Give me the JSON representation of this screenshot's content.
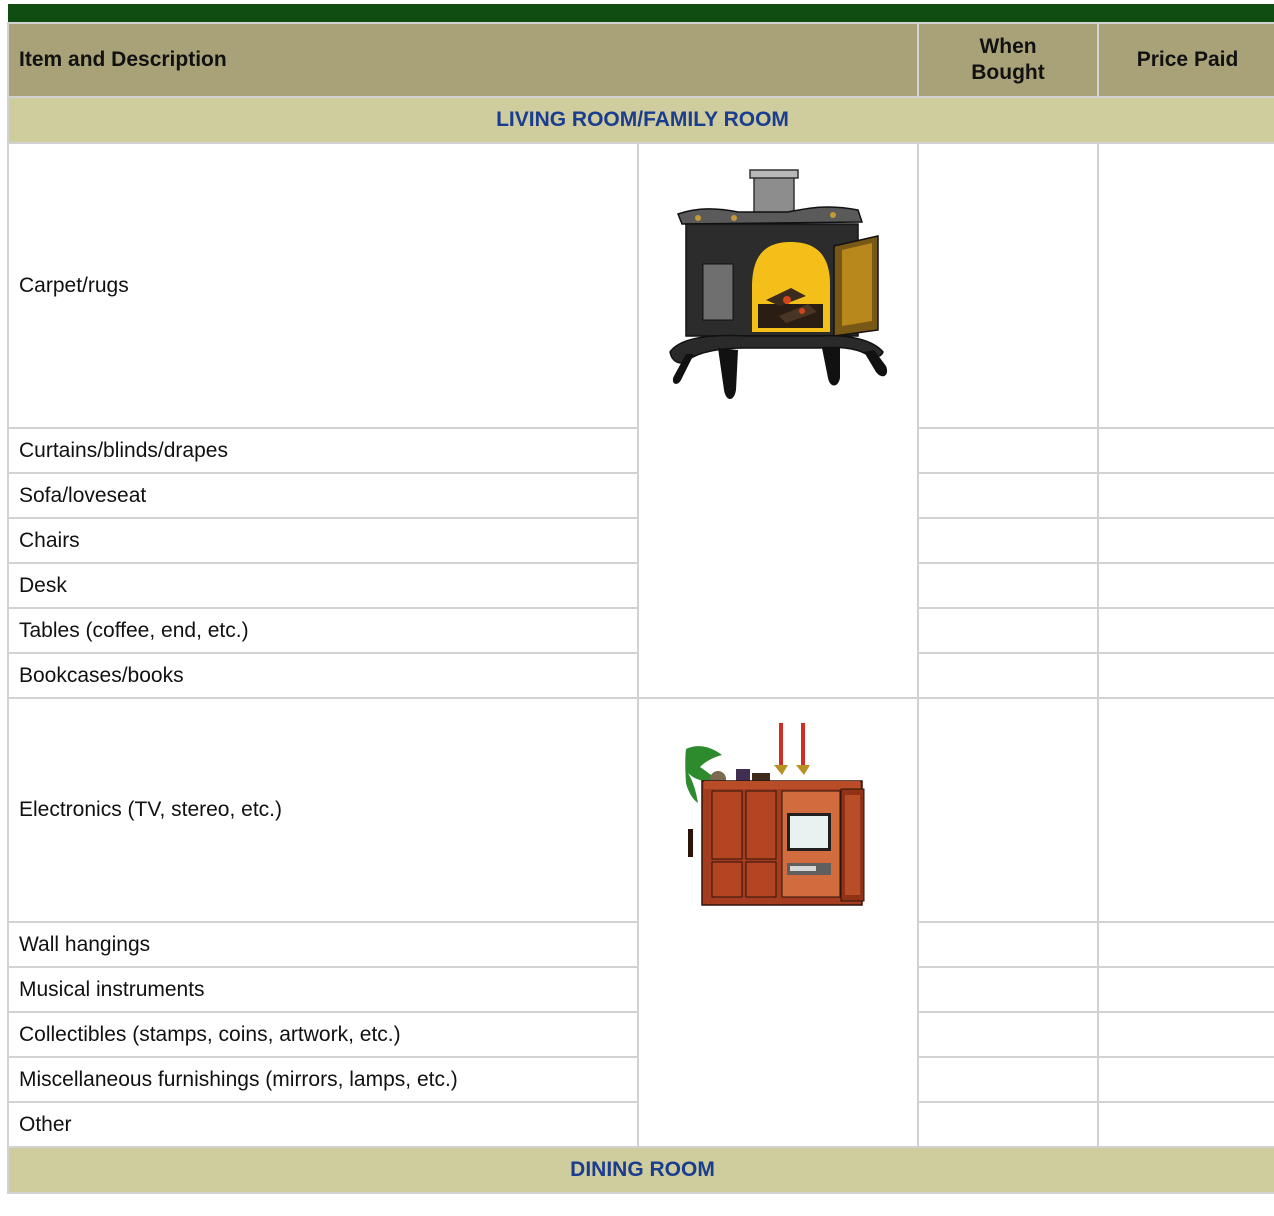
{
  "header": {
    "item": "Item  and Description",
    "when_line1": "When",
    "when_line2": "Bought",
    "price": "Price  Paid"
  },
  "sections": {
    "living": "LIVING  ROOM/FAMILY ROOM",
    "dining": "DINING  ROOM"
  },
  "items": [
    "Carpet/rugs",
    "Curtains/blinds/drapes",
    "Sofa/loveseat",
    "Chairs",
    "Desk",
    "Tables (coffee, end, etc.)",
    "Bookcases/books",
    "Electronics (TV, stereo, etc.)",
    "Wall hangings",
    "Musical instruments",
    "Collectibles (stamps, coins, artwork,  etc.)",
    "Miscellaneous furnishings (mirrors, lamps,  etc.)",
    "Other"
  ],
  "colors": {
    "top_bar": "#0f4d12",
    "header_bg": "#a9a279",
    "section_bg": "#cfcc9e",
    "section_text": "#1b3d8f",
    "grid": "#d2d2d2"
  },
  "icons": [
    "wood-stove-illustration",
    "entertainment-cabinet-illustration"
  ]
}
